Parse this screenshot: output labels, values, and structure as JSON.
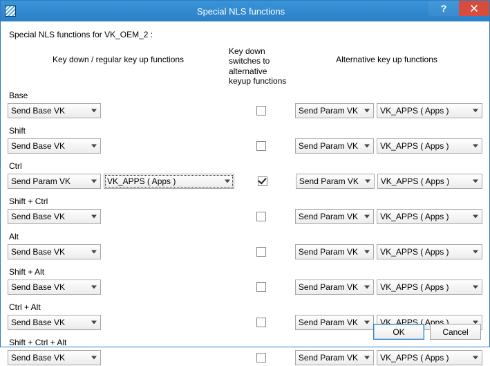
{
  "window": {
    "title": "Special NLS functions"
  },
  "subtitle": "Special NLS functions for VK_OEM_2 :",
  "headers": {
    "col1": "Key down / regular key up functions",
    "col2": "Key down switches to alternative keyup functions",
    "col3": "Alternative key up functions"
  },
  "rows": [
    {
      "label": "Base",
      "left1": "Send Base VK",
      "left2": null,
      "checked": false,
      "alt1": "Send Param VK",
      "alt2": "VK_APPS ( Apps )"
    },
    {
      "label": "Shift",
      "left1": "Send Base VK",
      "left2": null,
      "checked": false,
      "alt1": "Send Param VK",
      "alt2": "VK_APPS ( Apps )"
    },
    {
      "label": "Ctrl",
      "left1": "Send Param VK",
      "left2": "VK_APPS ( Apps )",
      "checked": true,
      "alt1": "Send Param VK",
      "alt2": "VK_APPS ( Apps )"
    },
    {
      "label": "Shift + Ctrl",
      "left1": "Send Base VK",
      "left2": null,
      "checked": false,
      "alt1": "Send Param VK",
      "alt2": "VK_APPS ( Apps )"
    },
    {
      "label": "Alt",
      "left1": "Send Base VK",
      "left2": null,
      "checked": false,
      "alt1": "Send Param VK",
      "alt2": "VK_APPS ( Apps )"
    },
    {
      "label": "Shift + Alt",
      "left1": "Send Base VK",
      "left2": null,
      "checked": false,
      "alt1": "Send Param VK",
      "alt2": "VK_APPS ( Apps )"
    },
    {
      "label": "Ctrl + Alt",
      "left1": "Send Base VK",
      "left2": null,
      "checked": false,
      "alt1": "Send Param VK",
      "alt2": "VK_APPS ( Apps )"
    },
    {
      "label": "Shift + Ctrl + Alt",
      "left1": "Send Base VK",
      "left2": null,
      "checked": false,
      "alt1": "Send Param VK",
      "alt2": "VK_APPS ( Apps )"
    }
  ],
  "buttons": {
    "ok": "OK",
    "cancel": "Cancel"
  }
}
